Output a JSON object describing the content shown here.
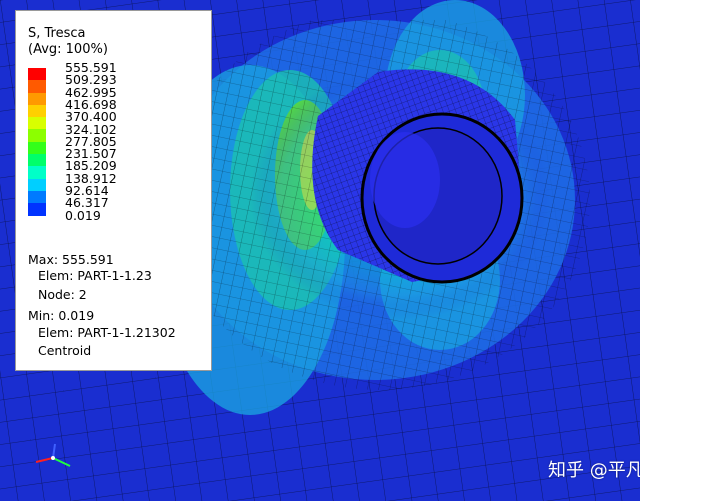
{
  "legend": {
    "title_line1": "S, Tresca",
    "title_line2": "(Avg: 100%)",
    "ticks": [
      "555.591",
      "509.293",
      "462.995",
      "416.698",
      "370.400",
      "324.102",
      "277.805",
      "231.507",
      "185.209",
      "138.912",
      "92.614",
      "46.317",
      "0.019"
    ],
    "band_colors": [
      "#ff0000",
      "#ff5a00",
      "#ff9900",
      "#ffd000",
      "#d8ff00",
      "#8cff00",
      "#33ff1a",
      "#00ff6a",
      "#00ffc8",
      "#00cfff",
      "#007aff",
      "#0033ff"
    ],
    "max_label": "Max: 555.591",
    "max_elem": "Elem: PART-1-1.23",
    "max_node": "Node: 2",
    "min_label": "Min: 0.019",
    "min_elem": "Elem: PART-1-1.21302",
    "min_loc": "Centroid"
  },
  "watermark": "知乎 @平凡的人",
  "colors": {
    "background_mesh": "#1a2ed0",
    "nozzle_fill": "#2a36e8",
    "nozzle_inner": "#1e2ad8",
    "mesh_line": "#000000"
  }
}
